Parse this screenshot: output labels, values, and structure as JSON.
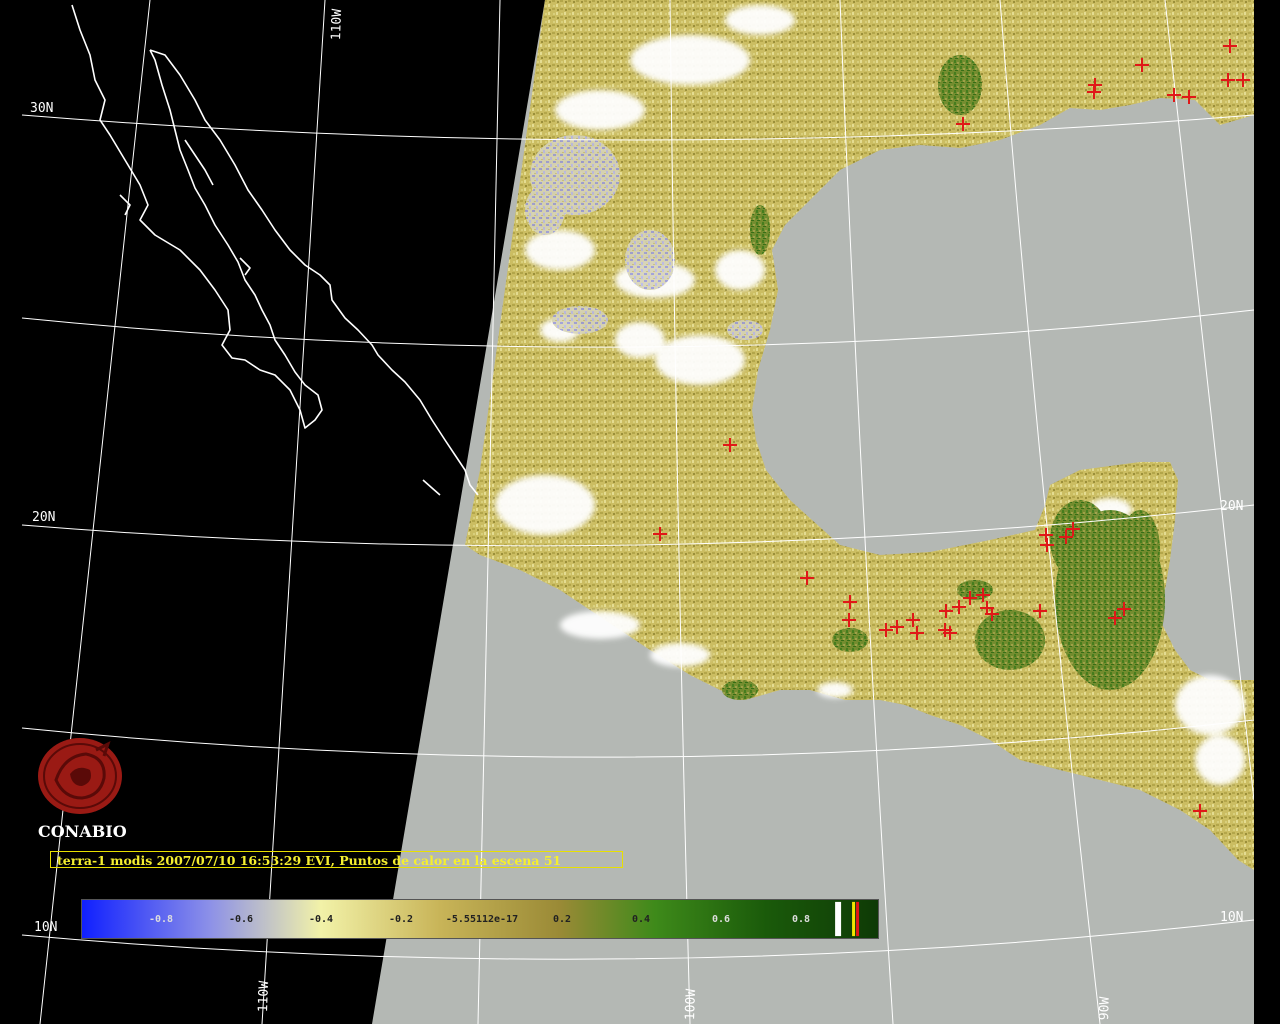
{
  "map": {
    "graticule_labels": {
      "lat_30n_left": "30N",
      "lat_20n_left": "20N",
      "lat_10n_left": "10N",
      "lat_20n_right": "20N",
      "lat_10n_right": "10N",
      "lon_110w_top": "110W",
      "lon_110w_bottom": "110W",
      "lon_100w_bottom": "100W",
      "lon_90w_bottom": "90W"
    },
    "organization": "CONABIO",
    "caption": "terra-1 modis 2007/07/10 16:53:29 EVI, Puntos de calor en la escena 51",
    "legend": {
      "ticks": [
        "-0.8",
        "-0.6",
        "-0.4",
        "-0.2",
        "-5.55112e-17",
        "0.2",
        "0.4",
        "0.6",
        "0.8"
      ],
      "color_stops": [
        "#1020ff",
        "#8c90e8",
        "#f2f2a8",
        "#c8b458",
        "#9a8a36",
        "#3e8a1a",
        "#1a5a0a",
        "#0e3a06"
      ]
    },
    "colors": {
      "background": "#000000",
      "ocean": "#b4b8b4",
      "coastline_baja": "#ffffff",
      "graticule": "#ffffff",
      "hotspot": "#e01818",
      "caption_text": "#f4ee30"
    },
    "hotspot_count": 51,
    "icons": [
      "conabio-logo-icon",
      "hotspot-cross-icon"
    ]
  }
}
